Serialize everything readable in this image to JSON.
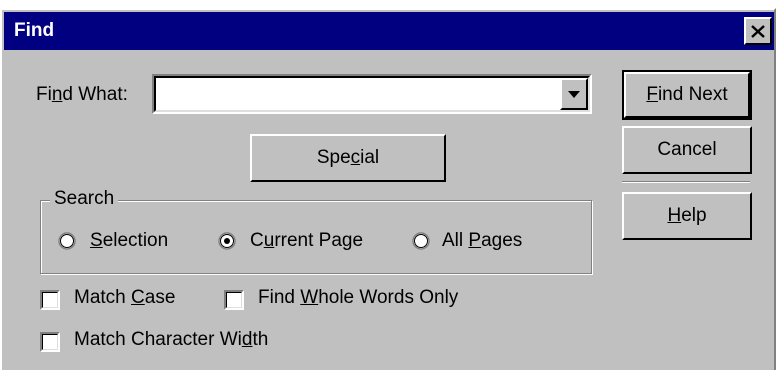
{
  "window": {
    "title": "Find"
  },
  "find": {
    "label_pre": "Fi",
    "label_key": "n",
    "label_post": "d What:",
    "value": ""
  },
  "buttons": {
    "find_next_key": "F",
    "find_next_rest": "ind Next",
    "cancel": "Cancel",
    "help_key": "H",
    "help_rest": "elp",
    "special_pre": "Spe",
    "special_key": "c",
    "special_post": "ial"
  },
  "search": {
    "group_label": "Search",
    "options": [
      {
        "key": "S",
        "rest": "election",
        "pre": "",
        "selected": false
      },
      {
        "pre": "C",
        "key": "u",
        "rest": "rrent Page",
        "selected": true
      },
      {
        "pre": "All ",
        "key": "P",
        "rest": "ages",
        "selected": false
      }
    ]
  },
  "options": {
    "match_case_pre": "Match ",
    "match_case_key": "C",
    "match_case_post": "ase",
    "whole_words_pre": "Find ",
    "whole_words_key": "W",
    "whole_words_post": "hole Words Only",
    "char_width_pre": "Match Character Wi",
    "char_width_key": "d",
    "char_width_post": "th",
    "match_case_checked": false,
    "whole_words_checked": false,
    "char_width_checked": false
  },
  "colors": {
    "titlebar": "#000080",
    "face": "#c0c0c0"
  },
  "icons": {
    "close": "close-icon",
    "dropdown": "dropdown-arrow-icon"
  }
}
